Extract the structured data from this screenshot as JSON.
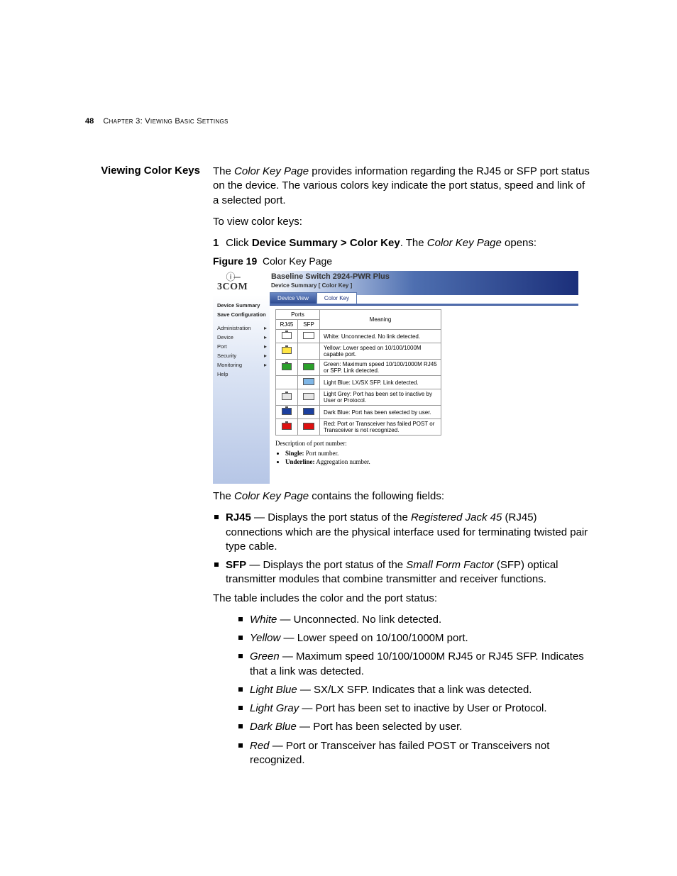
{
  "header": {
    "page_number": "48",
    "chapter": "Chapter 3: Viewing Basic Settings"
  },
  "section": {
    "heading": "Viewing Color Keys",
    "intro_1a": "The ",
    "intro_1_em": "Color Key Page",
    "intro_1b": " provides information regarding the RJ45 or SFP port status on the device. The various colors key indicate the port status, speed and link of a selected port.",
    "intro_2": "To view color keys:",
    "step_num": "1",
    "step_a": "Click ",
    "step_bold": "Device Summary > Color Key",
    "step_b": ". The ",
    "step_em": "Color Key Page",
    "step_c": " opens:",
    "fig_label": "Figure 19",
    "fig_caption": "Color Key Page"
  },
  "embed": {
    "brand": "3COM",
    "title1": "Baseline Switch 2924-PWR Plus",
    "title2": "Device Summary [ Color Key ]",
    "tabs": [
      {
        "label": "Device View",
        "active": true
      },
      {
        "label": "Color Key",
        "active": false
      }
    ],
    "sidebar": [
      {
        "label": "Device Summary",
        "bold": true,
        "arrow": false
      },
      {
        "label": "Save Configuration",
        "bold": true,
        "arrow": false
      },
      {
        "label": "Administration",
        "bold": false,
        "arrow": true
      },
      {
        "label": "Device",
        "bold": false,
        "arrow": true
      },
      {
        "label": "Port",
        "bold": false,
        "arrow": true
      },
      {
        "label": "Security",
        "bold": false,
        "arrow": true
      },
      {
        "label": "Monitoring",
        "bold": false,
        "arrow": true
      },
      {
        "label": "Help",
        "bold": false,
        "arrow": false
      }
    ],
    "table": {
      "ports_header": "Ports",
      "col_rj45": "RJ45",
      "col_sfp": "SFP",
      "col_meaning": "Meaning",
      "rows": [
        {
          "rj45_color": "#ffffff",
          "sfp_color": "#ffffff",
          "sfp_show": true,
          "meaning": "White: Unconnected. No link detected."
        },
        {
          "rj45_color": "#ffe544",
          "sfp_color": "",
          "sfp_show": false,
          "meaning": "Yellow: Lower speed on 10/100/1000M capable port."
        },
        {
          "rj45_color": "#2aa02a",
          "sfp_color": "#2aa02a",
          "sfp_show": true,
          "meaning": "Green: Maximum speed 10/100/1000M RJ45 or SFP. Link detected."
        },
        {
          "rj45_color": "",
          "sfp_color": "#7fb6e6",
          "sfp_show": true,
          "meaning": "Light Blue: LX/SX SFP. Link detected."
        },
        {
          "rj45_color": "#e6e6e6",
          "sfp_color": "#e6e6e6",
          "sfp_show": true,
          "meaning": "Light Grey: Port has been set to inactive by User or Protocol."
        },
        {
          "rj45_color": "#1b3f9e",
          "sfp_color": "#1b3f9e",
          "sfp_show": true,
          "meaning": "Dark Blue: Port has been selected by user."
        },
        {
          "rj45_color": "#d11",
          "sfp_color": "#d11",
          "sfp_show": true,
          "meaning": "Red: Port or Transceiver has failed POST or Transceiver is not recognized."
        }
      ]
    },
    "desc": {
      "title": "Description of port number:",
      "b1_bold": "Single:",
      "b1_rest": " Port number.",
      "b2_bold": "Underline:",
      "b2_rest": " Aggregation number."
    }
  },
  "after": {
    "p1a": "The ",
    "p1_em": "Color Key Page",
    "p1b": " contains the following fields:",
    "b1_bold": "RJ45",
    "b1_a": " — Displays the port status of the ",
    "b1_em": "Registered Jack 45",
    "b1_b": " (RJ45) connections which are the physical interface used for terminating twisted pair type cable.",
    "b2_bold": "SFP",
    "b2_a": " — Displays the port status of the ",
    "b2_em": "Small Form Factor",
    "b2_b": " (SFP) optical transmitter modules that combine transmitter and receiver functions.",
    "p2": "The table includes the color and the port status:",
    "colors": [
      {
        "name": "White",
        "text": " — Unconnected. No link detected."
      },
      {
        "name": "Yellow",
        "text": " — Lower speed on 10/100/1000M port."
      },
      {
        "name": "Green",
        "text": " — Maximum speed 10/100/1000M RJ45 or RJ45 SFP. Indicates that a link was detected."
      },
      {
        "name": "Light Blue",
        "text": " — SX/LX SFP. Indicates that a link was detected."
      },
      {
        "name": "Light Gray",
        "text": " — Port has been set to inactive by User or Protocol."
      },
      {
        "name": "Dark Blue",
        "text": " — Port has been selected by user."
      },
      {
        "name": "Red",
        "text": " — Port or Transceiver has failed POST or Transceivers not recognized."
      }
    ]
  }
}
